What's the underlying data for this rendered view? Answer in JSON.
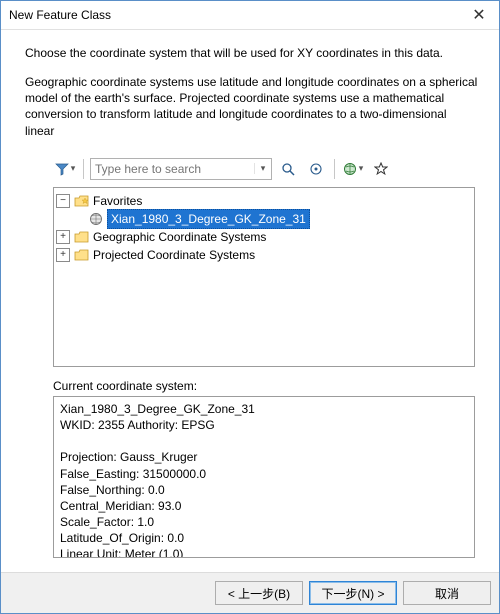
{
  "window": {
    "title": "New Feature Class"
  },
  "intro": {
    "line1": "Choose the coordinate system that will be used for XY coordinates in this data.",
    "line2": "Geographic coordinate systems use latitude and longitude coordinates on a spherical model of the earth's surface. Projected coordinate systems use a mathematical conversion to transform latitude and longitude coordinates to a two-dimensional linear"
  },
  "search": {
    "placeholder": "Type here to search"
  },
  "tree": {
    "favorites": {
      "label": "Favorites",
      "expanded": true,
      "children": [
        "Xian_1980_3_Degree_GK_Zone_31"
      ]
    },
    "geographic": {
      "label": "Geographic Coordinate Systems",
      "expanded": false
    },
    "projected": {
      "label": "Projected Coordinate Systems",
      "expanded": false
    }
  },
  "details": {
    "label": "Current coordinate system:",
    "text": "Xian_1980_3_Degree_GK_Zone_31\nWKID: 2355 Authority: EPSG\n\nProjection: Gauss_Kruger\nFalse_Easting: 31500000.0\nFalse_Northing: 0.0\nCentral_Meridian: 93.0\nScale_Factor: 1.0\nLatitude_Of_Origin: 0.0\nLinear Unit: Meter (1.0)"
  },
  "footer": {
    "back": "< 上一步(B)",
    "next": "下一步(N) >",
    "cancel": "取消"
  }
}
